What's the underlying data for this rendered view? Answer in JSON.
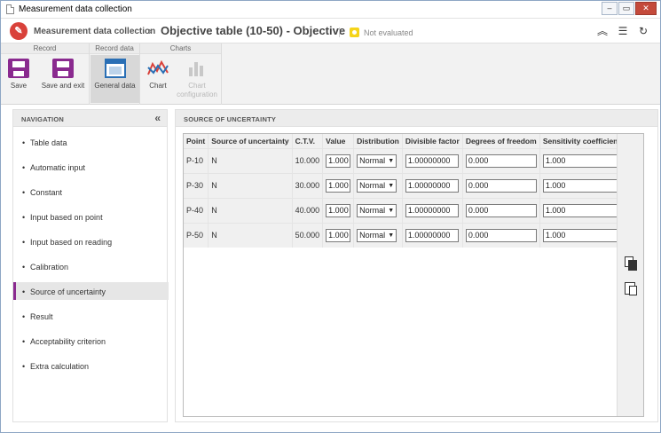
{
  "window": {
    "title": "Measurement data collection"
  },
  "header": {
    "breadcrumb_root": "Measurement data collection",
    "breadcrumb_sep": "›",
    "page_title": "Objective table (10-50) - Objective",
    "status": "Not evaluated"
  },
  "ribbon": {
    "groups": [
      {
        "label": "Record",
        "buttons": [
          {
            "label": "Save",
            "icon": "save-icon"
          },
          {
            "label": "Save and exit",
            "icon": "save-exit-icon"
          }
        ]
      },
      {
        "label": "Record data",
        "buttons": [
          {
            "label": "General data",
            "icon": "general-data-icon"
          }
        ]
      },
      {
        "label": "Charts",
        "buttons": [
          {
            "label": "Chart",
            "icon": "chart-icon"
          },
          {
            "label": "Chart configuration",
            "icon": "chart-config-icon",
            "disabled": true
          }
        ]
      }
    ]
  },
  "nav": {
    "title": "NAVIGATION",
    "collapse_glyph": "«",
    "items": [
      "Table data",
      "Automatic input",
      "Constant",
      "Input based on point",
      "Input based on reading",
      "Calibration",
      "Source of uncertainty",
      "Result",
      "Acceptability criterion",
      "Extra calculation"
    ],
    "active": "Source of uncertainty"
  },
  "section": {
    "title": "SOURCE OF UNCERTAINTY"
  },
  "table": {
    "columns": [
      "Point",
      "Source of uncertainty",
      "C.T.V.",
      "Value",
      "Distribution",
      "Divisible factor",
      "Degrees of freedom",
      "Sensitivity coefficient"
    ],
    "rows": [
      {
        "point": "P-10",
        "source": "N",
        "ctv": "10.000",
        "value": "1.000",
        "distribution": "Normal",
        "divisible": "1.00000000",
        "dof": "0.000",
        "sensitivity": "1.000"
      },
      {
        "point": "P-30",
        "source": "N",
        "ctv": "30.000",
        "value": "1.000",
        "distribution": "Normal",
        "divisible": "1.00000000",
        "dof": "0.000",
        "sensitivity": "1.000"
      },
      {
        "point": "P-40",
        "source": "N",
        "ctv": "40.000",
        "value": "1.000",
        "distribution": "Normal",
        "divisible": "1.00000000",
        "dof": "0.000",
        "sensitivity": "1.000"
      },
      {
        "point": "P-50",
        "source": "N",
        "ctv": "50.000",
        "value": "1.000",
        "distribution": "Normal",
        "divisible": "1.00000000",
        "dof": "0.000",
        "sensitivity": "1.000"
      }
    ]
  },
  "colors": {
    "accent": "#8a2a8f",
    "logo": "#d9413a",
    "status": "#f5d41a"
  }
}
